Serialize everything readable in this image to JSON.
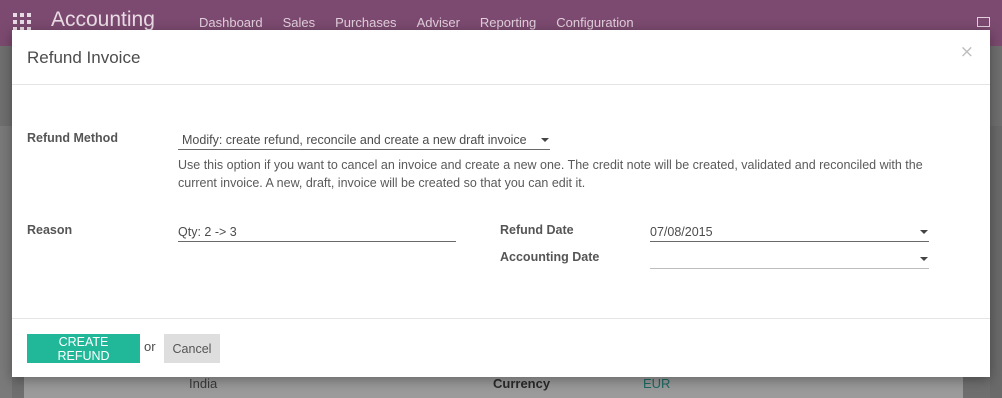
{
  "app": {
    "title": "Accounting",
    "menu": [
      "Dashboard",
      "Sales",
      "Purchases",
      "Adviser",
      "Reporting",
      "Configuration"
    ],
    "background": {
      "country": "India",
      "currency_label": "Currency",
      "currency_value": "EUR"
    }
  },
  "dialog": {
    "title": "Refund Invoice",
    "close_symbol": "×",
    "refund_method": {
      "label": "Refund Method",
      "value": "Modify: create refund, reconcile and create a new draft invoice",
      "help": "Use this option if you want to cancel an invoice and create a new one. The credit note will be created, validated and reconciled with the current invoice. A new, draft, invoice will be created so that you can edit it."
    },
    "reason": {
      "label": "Reason",
      "value": "Qty: 2 -> 3"
    },
    "refund_date": {
      "label": "Refund Date",
      "value": "07/08/2015"
    },
    "accounting_date": {
      "label": "Accounting Date",
      "value": ""
    },
    "footer": {
      "create_label": "CREATE REFUND",
      "or_text": "or",
      "cancel_label": "Cancel"
    }
  },
  "colors": {
    "topbar": "#7c4a70",
    "primary_button": "#21b799",
    "secondary_button": "#dedede"
  }
}
